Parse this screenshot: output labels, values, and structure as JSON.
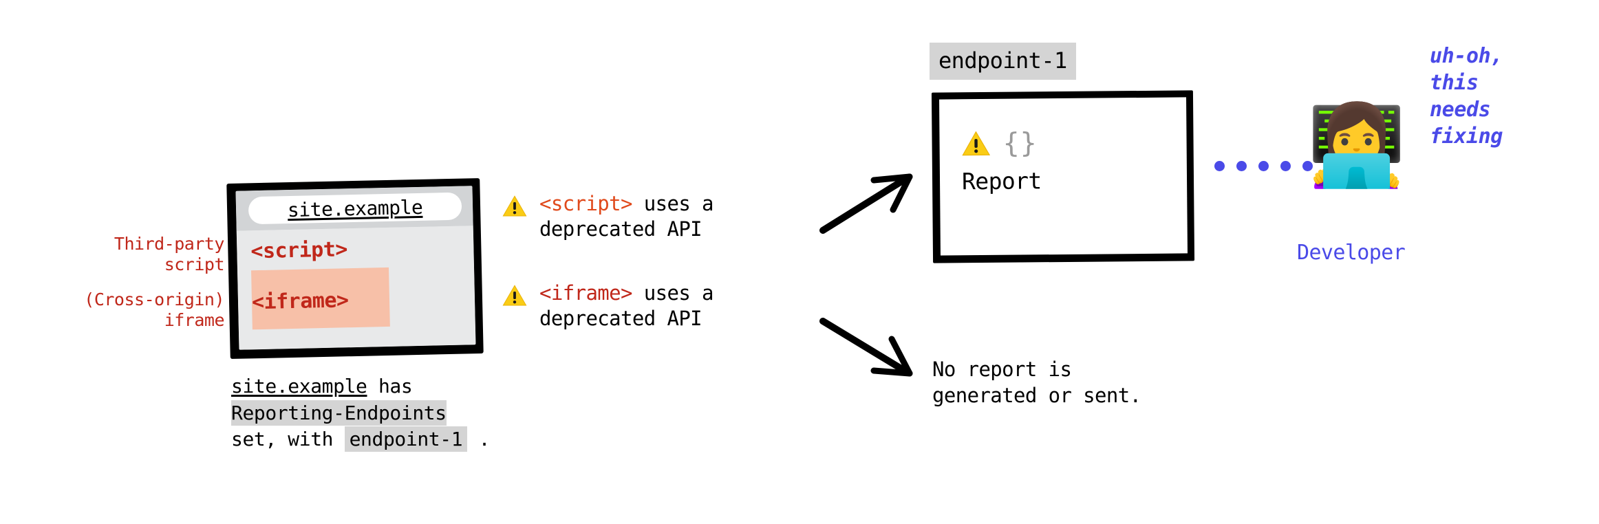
{
  "diagram": {
    "left_annotations": [
      {
        "name": "third-party-script",
        "lines": [
          "Third-party",
          "script"
        ]
      },
      {
        "name": "cross-origin-iframe",
        "lines": [
          "(Cross-origin)",
          "iframe"
        ]
      }
    ],
    "browser": {
      "url": "site.example",
      "content": [
        {
          "tag": "<script>",
          "highlighted": false
        },
        {
          "tag": "<iframe>",
          "highlighted": true
        }
      ],
      "caption": {
        "line1_link": "site.example",
        "line1_rest": " has",
        "line2_code": "Reporting-Endpoints",
        "line3_pre": "set, with ",
        "line3_code": "endpoint-1",
        "line3_post": " ."
      }
    },
    "warnings": [
      {
        "icon": "warning-triangle-icon",
        "tag": "<script>",
        "tag_color": "#E0491B",
        "line1_rest": " uses a",
        "line2": "deprecated API"
      },
      {
        "icon": "warning-triangle-icon",
        "tag": "<iframe>",
        "tag_color": "#C0271A",
        "line1_rest": " uses a",
        "line2": "deprecated API"
      }
    ],
    "report": {
      "endpoint_label": "endpoint-1",
      "icon": "warning-triangle-icon",
      "braces": "{}",
      "label": "Report"
    },
    "no_report": {
      "line1": "No report is",
      "line2": "generated or sent."
    },
    "connector": {
      "icon": "dotted-line-icon",
      "dot_count": 6,
      "color": "#4A4AE8"
    },
    "developer": {
      "avatar_icon": "woman-technologist-emoji",
      "avatar_glyph": "👩‍💻",
      "label": "Developer",
      "thought": [
        "uh-oh,",
        "this",
        "needs",
        "fixing"
      ]
    },
    "arrows": [
      {
        "name": "arrow-to-report",
        "direction": "up-right"
      },
      {
        "name": "arrow-to-no-report",
        "direction": "down-right"
      }
    ],
    "colors": {
      "red_annotation": "#C0271A",
      "orange_tag": "#E0491B",
      "blue_developer": "#4A4AE8",
      "code_highlight_gray": "#D4D4D4",
      "iframe_highlight_salmon": "#F7C0A8",
      "browser_body_gray": "#E8E9EA",
      "browser_chrome_gray": "#D2D4D6",
      "warning_yellow": "#FACC15",
      "braces_gray": "#9A9A9A"
    }
  }
}
